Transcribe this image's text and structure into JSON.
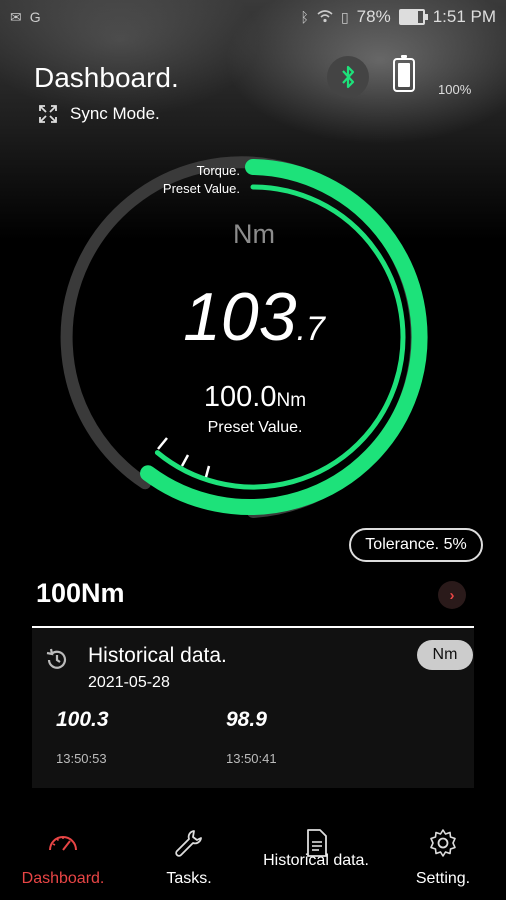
{
  "status_bar": {
    "battery_percent": "78%",
    "time": "1:51 PM"
  },
  "header": {
    "title": "Dashboard.",
    "sync_label": "Sync Mode.",
    "device_battery": "100%",
    "device_battery_level": 1.0,
    "bluetooth_color": "#1de27a"
  },
  "gauge": {
    "torque_label": "Torque.",
    "preset_label": "Preset Value.",
    "unit": "Nm",
    "value_int": "103",
    "value_dec": ".7",
    "preset_value": "100.0",
    "preset_unit": "Nm",
    "preset_caption": "Preset Value.",
    "accent_color": "#1de27a"
  },
  "tolerance": "Tolerance. 5%",
  "task": {
    "name": "100Nm"
  },
  "history": {
    "title": "Historical data.",
    "date": "2021-05-28",
    "unit": "Nm",
    "records": [
      {
        "value": "100.3",
        "time": "13:50:53"
      },
      {
        "value": "98.9",
        "time": "13:50:41"
      }
    ]
  },
  "nav": {
    "items": [
      {
        "label": "Dashboard.",
        "icon": "gauge-icon"
      },
      {
        "label": "Tasks.",
        "icon": "wrench-icon"
      },
      {
        "label": "Historical data.",
        "icon": "document-icon"
      },
      {
        "label": "Setting.",
        "icon": "gear-icon"
      }
    ],
    "active_color": "#e84545"
  }
}
